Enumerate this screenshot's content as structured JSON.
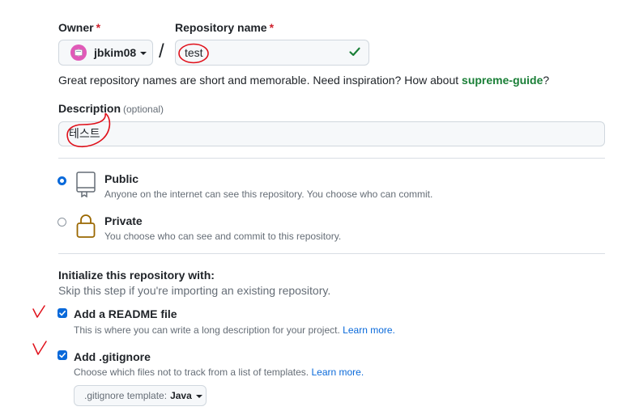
{
  "owner": {
    "label": "Owner",
    "required": "*",
    "name": "jbkim08"
  },
  "repo": {
    "label": "Repository name",
    "required": "*",
    "value": "test",
    "separator": "/"
  },
  "hint": {
    "prefix": "Great repository names are short and memorable. Need inspiration? How about ",
    "suggestion": "supreme-guide",
    "suffix": "?"
  },
  "description": {
    "label": "Description",
    "optional": "(optional)",
    "value": "테스트"
  },
  "visibility": {
    "public": {
      "title": "Public",
      "desc": "Anyone on the internet can see this repository. You choose who can commit."
    },
    "private": {
      "title": "Private",
      "desc": "You choose who can see and commit to this repository."
    }
  },
  "init": {
    "title": "Initialize this repository with:",
    "subtitle": "Skip this step if you're importing an existing repository.",
    "readme": {
      "title": "Add a README file",
      "desc": "This is where you can write a long description for your project.",
      "link": "Learn more."
    },
    "gitignore": {
      "title": "Add .gitignore",
      "desc": "Choose which files not to track from a list of templates.",
      "link": "Learn more.",
      "template_label": ".gitignore template:",
      "template_value": "Java"
    }
  },
  "colors": {
    "accent": "#0969da",
    "success": "#1a7f37",
    "annotation": "#e0111b"
  }
}
